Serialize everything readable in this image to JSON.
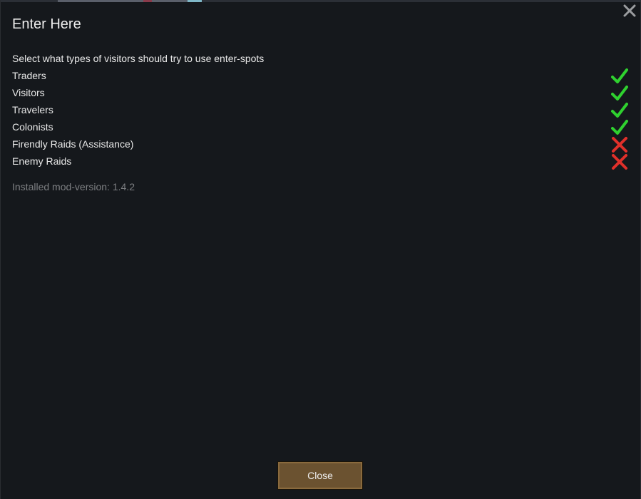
{
  "dialog": {
    "title": "Enter Here",
    "description": "Select what types of visitors should try to use enter-spots",
    "options": [
      {
        "label": "Traders",
        "enabled": true,
        "icon": "check-icon"
      },
      {
        "label": "Visitors",
        "enabled": true,
        "icon": "check-icon"
      },
      {
        "label": "Travelers",
        "enabled": true,
        "icon": "check-icon"
      },
      {
        "label": "Colonists",
        "enabled": true,
        "icon": "check-icon"
      },
      {
        "label": "Firendly Raids (Assistance)",
        "enabled": false,
        "icon": "cross-icon"
      },
      {
        "label": "Enemy Raids",
        "enabled": false,
        "icon": "cross-icon"
      }
    ],
    "version_text": "Installed mod-version: 1.4.2",
    "close_button_label": "Close",
    "close_icon": "close-icon"
  },
  "colors": {
    "background": "#15181c",
    "check": "#2fd12f",
    "cross": "#e0302a",
    "button": "#6b5230",
    "muted_text": "#7d7f82"
  }
}
